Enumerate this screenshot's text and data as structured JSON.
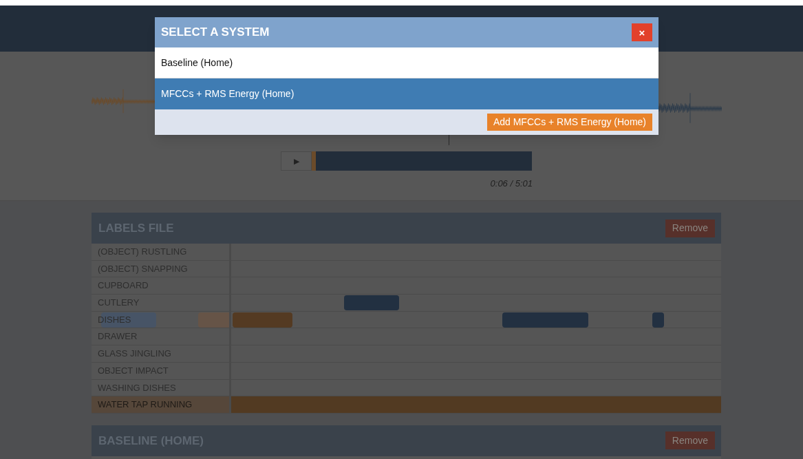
{
  "modal": {
    "title": "SELECT A SYSTEM",
    "close": "×",
    "options": [
      {
        "label": "Baseline (Home)",
        "selected": false
      },
      {
        "label": "MFCCs + RMS Energy (Home)",
        "selected": true
      }
    ],
    "add_button": "Add MFCCs + RMS Energy (Home)"
  },
  "player": {
    "play": "▶",
    "level": 0.02,
    "time": "0:06 / 5:01"
  },
  "labels_file": {
    "title": "LABELS FILE",
    "remove": "Remove",
    "rows": [
      {
        "label": "(OBJECT) RUSTLING",
        "selected": false
      },
      {
        "label": "(OBJECT) SNAPPING",
        "selected": false
      },
      {
        "label": "CUPBOARD",
        "selected": false
      },
      {
        "label": "CUTLERY",
        "selected": false
      },
      {
        "label": "DISHES",
        "selected": false
      },
      {
        "label": "DRAWER",
        "selected": false
      },
      {
        "label": "GLASS JINGLING",
        "selected": false
      },
      {
        "label": "OBJECT IMPACT",
        "selected": false
      },
      {
        "label": "WASHING DISHES",
        "selected": false
      },
      {
        "label": "WATER TAP RUNNING",
        "selected": true
      }
    ]
  },
  "baseline": {
    "title": "BASELINE (HOME)",
    "remove": "Remove"
  }
}
